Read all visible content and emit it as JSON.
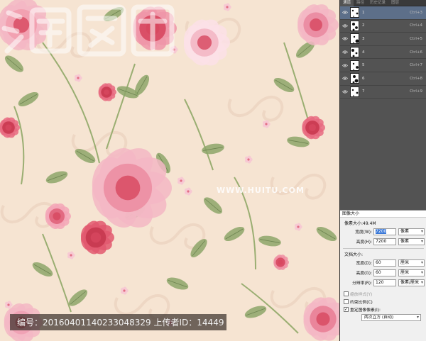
{
  "canvas": {
    "caption": "编号：20160401140233048329 上传者ID：14449",
    "watermark_url": "WWW.HUITU.COM",
    "colors": {
      "background": "#f6e4d2",
      "rose_dark": "#d7475f",
      "rose_light": "#f3b7c4",
      "leaf": "#8da66a"
    }
  },
  "panel": {
    "tabs": [
      "通道",
      "路径",
      "历史记录",
      "图层"
    ],
    "channels": [
      {
        "name": "1",
        "shortcut": "Ctrl+3"
      },
      {
        "name": "2",
        "shortcut": "Ctrl+4"
      },
      {
        "name": "3",
        "shortcut": "Ctrl+5"
      },
      {
        "name": "4",
        "shortcut": "Ctrl+6"
      },
      {
        "name": "5",
        "shortcut": "Ctrl+7"
      },
      {
        "name": "6",
        "shortcut": "Ctrl+8"
      },
      {
        "name": "7",
        "shortcut": "Ctrl+9"
      }
    ],
    "selected_channel": "1"
  },
  "dialog": {
    "title": "图像大小",
    "pixel_dimensions": "像素大小:49.4M",
    "width_label": "宽度(W):",
    "width_value": "7200",
    "width_unit": "像素",
    "height_label": "高度(H):",
    "height_value": "7200",
    "height_unit": "像素",
    "document_size": "文档大小:",
    "doc_width_label": "宽度(D):",
    "doc_width_value": "60",
    "doc_width_unit": "厘米",
    "doc_height_label": "高度(G):",
    "doc_height_value": "60",
    "doc_height_unit": "厘米",
    "resolution_label": "分辨率(R):",
    "resolution_value": "120",
    "resolution_unit": "像素/厘米",
    "scale_styles": "缩放样式(Y)",
    "constrain_proportions": "约束比例(C)",
    "resample": "重定图像像素(I):",
    "resample_method": "两次立方 (自动)"
  }
}
